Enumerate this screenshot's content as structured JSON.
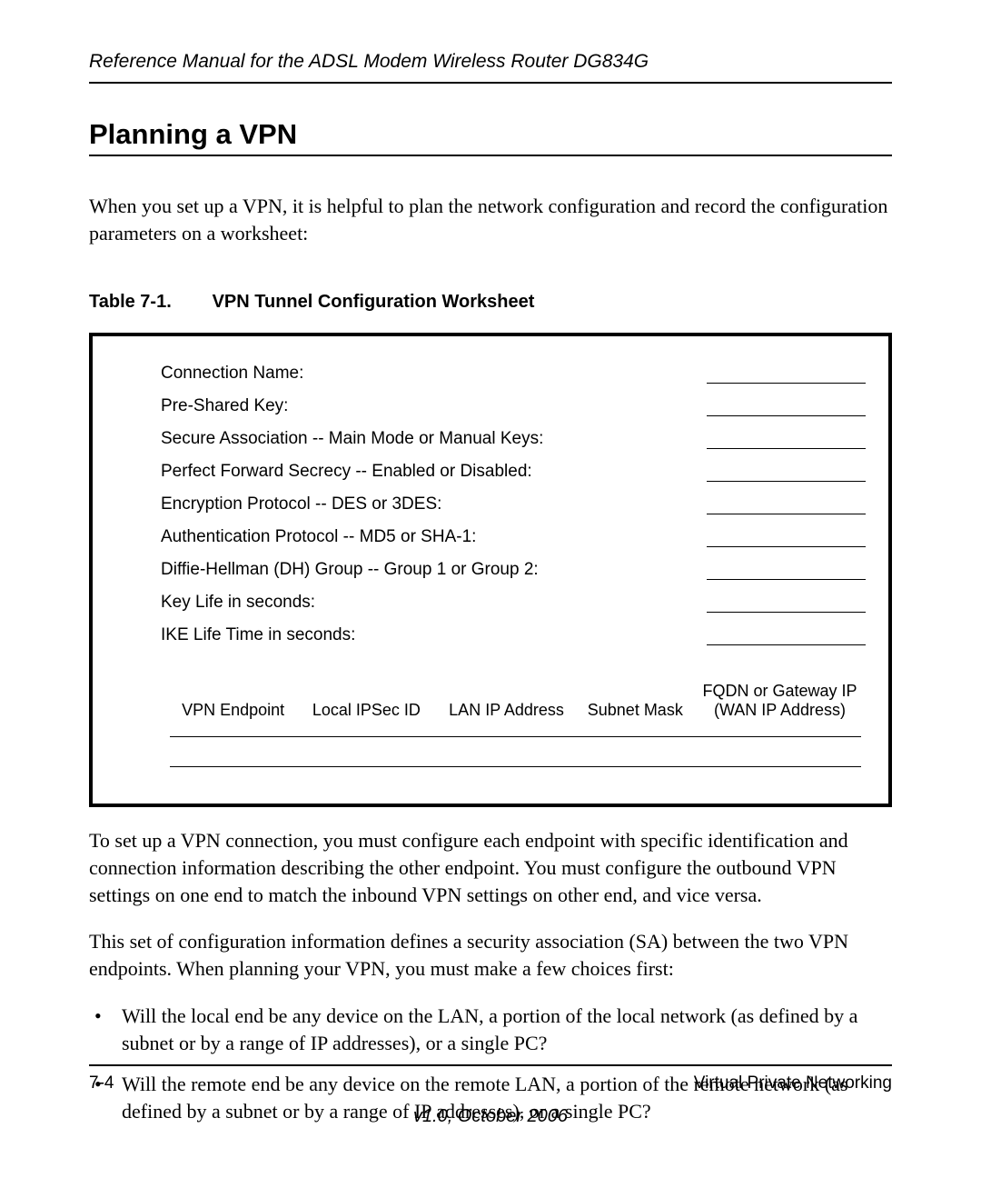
{
  "header": {
    "reference": "Reference Manual for the ADSL Modem Wireless Router DG834G"
  },
  "section": {
    "title": "Planning a VPN",
    "intro": "When you set up a VPN, it is helpful to plan the network configuration and record the configuration parameters on a worksheet:"
  },
  "table": {
    "caption_label": "Table 7-1.",
    "caption_title": "VPN Tunnel Configuration Worksheet",
    "fields": [
      "Connection Name:",
      "Pre-Shared Key:",
      "Secure Association -- Main Mode or Manual Keys:",
      "Perfect Forward Secrecy -- Enabled or Disabled:",
      "Encryption Protocol -- DES or 3DES:",
      "Authentication Protocol -- MD5 or SHA-1:",
      "Diffie-Hellman (DH) Group -- Group 1 or Group 2:",
      "Key Life in seconds:",
      "IKE Life Time in seconds:"
    ],
    "endpoint_headers": {
      "col1": "VPN Endpoint",
      "col2": "Local IPSec ID",
      "col3": "LAN IP Address",
      "col4": "Subnet Mask",
      "col5_line1": "FQDN or Gateway IP",
      "col5_line2": "(WAN IP Address)"
    }
  },
  "paragraphs": {
    "p1": "To set up a VPN connection, you must configure each endpoint with specific identification and connection information describing the other endpoint. You must configure the outbound VPN settings on one end to match the inbound VPN settings on other end, and vice versa.",
    "p2": "This set of configuration information defines a security association (SA) between the two VPN endpoints. When planning your VPN, you must make a few choices first:"
  },
  "bullets": [
    "Will the local end be any device on the LAN, a portion of the local network (as defined by a subnet or by a range of IP addresses), or a single PC?",
    "Will the remote end be any device on the remote LAN, a portion of the remote network (as defined by a subnet or by a range of IP addresses), or a single PC?"
  ],
  "footer": {
    "page": "7-4",
    "chapter": "Virtual Private Networking",
    "version": "v1.0, October 2006"
  }
}
